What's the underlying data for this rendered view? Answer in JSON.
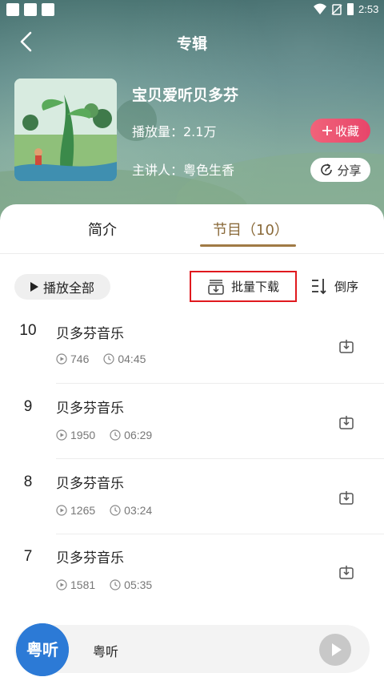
{
  "status_bar": {
    "time": "2:53"
  },
  "header": {
    "title": "专辑"
  },
  "album": {
    "name": "宝贝爱听贝多芬",
    "plays_label": "播放量：2.1万",
    "host_label": "主讲人：粤色生香",
    "favorite_label": "收藏",
    "share_label": "分享"
  },
  "tabs": [
    {
      "label": "简介",
      "active": false
    },
    {
      "label": "节目（10）",
      "active": true
    }
  ],
  "actions": {
    "play_all": "播放全部",
    "batch_download": "批量下载",
    "sort": "倒序"
  },
  "episodes": [
    {
      "number": "10",
      "title": "贝多芬音乐",
      "plays": "746",
      "duration": "04:45"
    },
    {
      "number": "9",
      "title": "贝多芬音乐",
      "plays": "1950",
      "duration": "06:29"
    },
    {
      "number": "8",
      "title": "贝多芬音乐",
      "plays": "1265",
      "duration": "03:24"
    },
    {
      "number": "7",
      "title": "贝多芬音乐",
      "plays": "1581",
      "duration": "05:35"
    }
  ],
  "player": {
    "title": "粤听",
    "logo_text": "粤听"
  },
  "colors": {
    "accent": "#a07a45",
    "favorite": "#e8456a",
    "highlight_box": "#e0191e",
    "player_logo": "#2c7ad6"
  },
  "icons": {
    "back": "chevron-left-icon",
    "plus": "plus-icon",
    "share": "share-icon",
    "play": "play-icon",
    "batch_download": "download-tray-icon",
    "sort": "sort-icon",
    "plays": "play-count-icon",
    "duration": "clock-icon",
    "download": "download-icon"
  }
}
